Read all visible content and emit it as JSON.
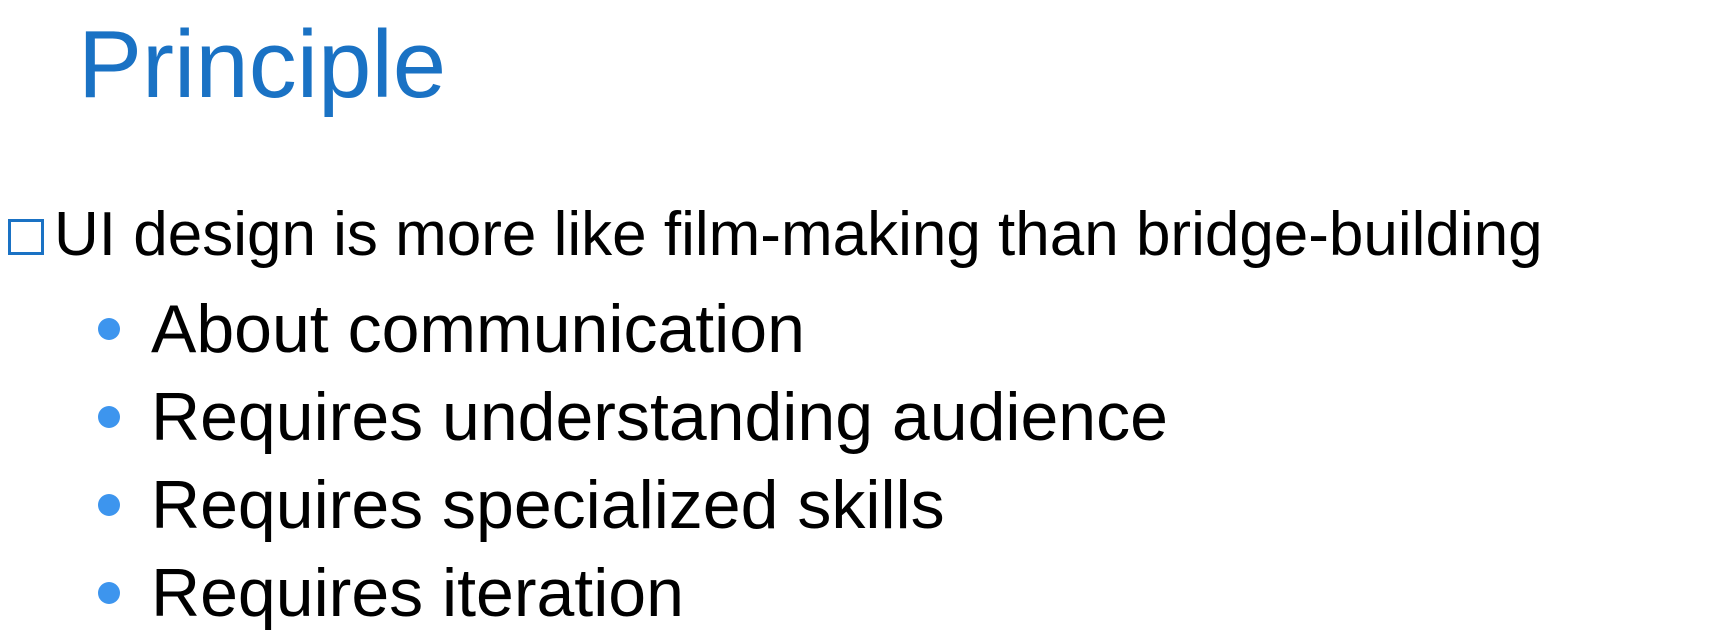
{
  "slide": {
    "title": "Principle",
    "title_color": "#1a72c4",
    "bullet_square_color": "#1a72c4",
    "dot_color": "#3d95ee",
    "main_point": {
      "icon": "square-bullet-icon",
      "text": "UI design is more like film-making than bridge-building"
    },
    "sub_points": [
      {
        "icon": "dot-bullet-icon",
        "text": "About communication"
      },
      {
        "icon": "dot-bullet-icon",
        "text": "Requires understanding audience"
      },
      {
        "icon": "dot-bullet-icon",
        "text": "Requires specialized skills"
      },
      {
        "icon": "dot-bullet-icon",
        "text": "Requires iteration"
      }
    ]
  }
}
